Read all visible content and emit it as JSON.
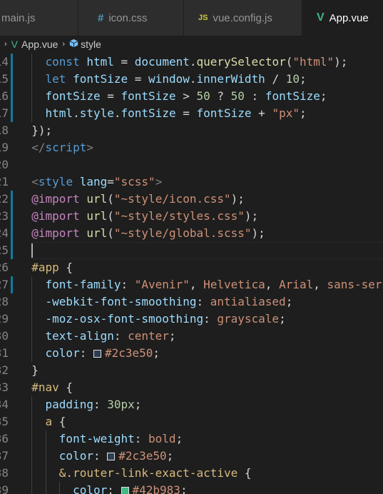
{
  "tabs": [
    {
      "label": "main.js",
      "icon": "file-js-icon",
      "active": false
    },
    {
      "label": "icon.css",
      "icon": "hash-icon",
      "active": false
    },
    {
      "label": "vue.config.js",
      "icon": "js-icon",
      "active": false
    },
    {
      "label": "App.vue",
      "icon": "vue-icon",
      "active": true
    }
  ],
  "tab_glyphs": {
    "hash": "#",
    "js": "JS",
    "vue": "V"
  },
  "breadcrumb": {
    "file": "App.vue",
    "section": "style",
    "separator": "›"
  },
  "colors": {
    "background": "#1e1e1e",
    "tab_inactive": "#2d2d2d",
    "vue_green": "#41b883",
    "swatch_a": "#2c3e50",
    "swatch_b": "#42b983"
  },
  "lines": [
    {
      "n": "14",
      "mod": true,
      "tokens": [
        [
          "    ",
          ""
        ],
        [
          "const",
          "kw"
        ],
        [
          " ",
          ""
        ],
        [
          "html",
          "vr"
        ],
        [
          " = ",
          "pu"
        ],
        [
          "document",
          "vr"
        ],
        [
          ".",
          "pu"
        ],
        [
          "querySelector",
          "fn"
        ],
        [
          "(",
          "pu"
        ],
        [
          "\"html\"",
          "st"
        ],
        [
          ");",
          "pu"
        ]
      ]
    },
    {
      "n": "15",
      "mod": true,
      "tokens": [
        [
          "    ",
          ""
        ],
        [
          "let",
          "kw"
        ],
        [
          " ",
          ""
        ],
        [
          "fontSize",
          "vr"
        ],
        [
          " = ",
          "pu"
        ],
        [
          "window",
          "vr"
        ],
        [
          ".",
          "pu"
        ],
        [
          "innerWidth",
          "vr"
        ],
        [
          " / ",
          "pu"
        ],
        [
          "10",
          "nm"
        ],
        [
          ";",
          "pu"
        ]
      ]
    },
    {
      "n": "16",
      "mod": true,
      "tokens": [
        [
          "    ",
          ""
        ],
        [
          "fontSize",
          "vr"
        ],
        [
          " = ",
          "pu"
        ],
        [
          "fontSize",
          "vr"
        ],
        [
          " > ",
          "pu"
        ],
        [
          "50",
          "nm"
        ],
        [
          " ? ",
          "pu"
        ],
        [
          "50",
          "nm"
        ],
        [
          " : ",
          "pu"
        ],
        [
          "fontSize",
          "vr"
        ],
        [
          ";",
          "pu"
        ]
      ]
    },
    {
      "n": "17",
      "mod": true,
      "tokens": [
        [
          "    ",
          ""
        ],
        [
          "html",
          "vr"
        ],
        [
          ".",
          "pu"
        ],
        [
          "style",
          "vr"
        ],
        [
          ".",
          "pu"
        ],
        [
          "fontSize",
          "vr"
        ],
        [
          " = ",
          "pu"
        ],
        [
          "fontSize",
          "vr"
        ],
        [
          " + ",
          "pu"
        ],
        [
          "\"px\"",
          "st"
        ],
        [
          ";",
          "pu"
        ]
      ]
    },
    {
      "n": "18",
      "mod": false,
      "tokens": [
        [
          "  ",
          ""
        ],
        [
          "});",
          "pu"
        ]
      ]
    },
    {
      "n": "19",
      "mod": false,
      "tokens": [
        [
          "  ",
          ""
        ],
        [
          "</",
          "br"
        ],
        [
          "script",
          "tg"
        ],
        [
          ">",
          "br"
        ]
      ]
    },
    {
      "n": "20",
      "mod": false,
      "tokens": []
    },
    {
      "n": "21",
      "mod": false,
      "tokens": [
        [
          "  ",
          ""
        ],
        [
          "<",
          "br"
        ],
        [
          "style",
          "tg"
        ],
        [
          " ",
          ""
        ],
        [
          "lang",
          "at"
        ],
        [
          "=",
          "pu"
        ],
        [
          "\"scss\"",
          "st"
        ],
        [
          ">",
          "br"
        ]
      ]
    },
    {
      "n": "22",
      "mod": true,
      "tokens": [
        [
          "  ",
          ""
        ],
        [
          "@import",
          "imp"
        ],
        [
          " ",
          ""
        ],
        [
          "url",
          "fn"
        ],
        [
          "(",
          "pu"
        ],
        [
          "\"~style/icon.css\"",
          "st"
        ],
        [
          ");",
          "pu"
        ]
      ]
    },
    {
      "n": "23",
      "mod": true,
      "tokens": [
        [
          "  ",
          ""
        ],
        [
          "@import",
          "imp"
        ],
        [
          " ",
          ""
        ],
        [
          "url",
          "fn"
        ],
        [
          "(",
          "pu"
        ],
        [
          "\"~style/styles.css\"",
          "st"
        ],
        [
          ");",
          "pu"
        ]
      ]
    },
    {
      "n": "24",
      "mod": true,
      "tokens": [
        [
          "  ",
          ""
        ],
        [
          "@import",
          "imp"
        ],
        [
          " ",
          ""
        ],
        [
          "url",
          "fn"
        ],
        [
          "(",
          "pu"
        ],
        [
          "\"~style/global.scss\"",
          "st"
        ],
        [
          ");",
          "pu"
        ]
      ]
    },
    {
      "n": "25",
      "mod": true,
      "current": true,
      "tokens": []
    },
    {
      "n": "26",
      "mod": false,
      "tokens": [
        [
          "  ",
          ""
        ],
        [
          "#app",
          "sel"
        ],
        [
          " {",
          "pu"
        ]
      ]
    },
    {
      "n": "27",
      "mod": true,
      "tokens": [
        [
          "    ",
          ""
        ],
        [
          "font-family",
          "pr"
        ],
        [
          ": ",
          "pu"
        ],
        [
          "\"Avenir\"",
          "st"
        ],
        [
          ", ",
          "pu"
        ],
        [
          "Helvetica",
          "cv"
        ],
        [
          ", ",
          "pu"
        ],
        [
          "Arial",
          "cv"
        ],
        [
          ", ",
          "pu"
        ],
        [
          "sans-serif",
          "cv"
        ],
        [
          ";",
          "pu"
        ]
      ]
    },
    {
      "n": "28",
      "mod": false,
      "tokens": [
        [
          "    ",
          ""
        ],
        [
          "-webkit-font-smoothing",
          "pr"
        ],
        [
          ": ",
          "pu"
        ],
        [
          "antialiased",
          "cv"
        ],
        [
          ";",
          "pu"
        ]
      ]
    },
    {
      "n": "29",
      "mod": false,
      "tokens": [
        [
          "    ",
          ""
        ],
        [
          "-moz-osx-font-smoothing",
          "pr"
        ],
        [
          ": ",
          "pu"
        ],
        [
          "grayscale",
          "cv"
        ],
        [
          ";",
          "pu"
        ]
      ]
    },
    {
      "n": "30",
      "mod": false,
      "tokens": [
        [
          "    ",
          ""
        ],
        [
          "text-align",
          "pr"
        ],
        [
          ": ",
          "pu"
        ],
        [
          "center",
          "cv"
        ],
        [
          ";",
          "pu"
        ]
      ]
    },
    {
      "n": "31",
      "mod": false,
      "tokens": [
        [
          "    ",
          ""
        ],
        [
          "color",
          "pr"
        ],
        [
          ": ",
          "pu"
        ],
        [
          "#2c3e50",
          "cv",
          "swatch_a"
        ],
        [
          ";",
          "pu"
        ]
      ]
    },
    {
      "n": "32",
      "mod": false,
      "tokens": [
        [
          "  ",
          ""
        ],
        [
          "}",
          "pu"
        ]
      ]
    },
    {
      "n": "33",
      "mod": false,
      "tokens": [
        [
          "  ",
          ""
        ],
        [
          "#nav",
          "sel"
        ],
        [
          " {",
          "pu"
        ]
      ]
    },
    {
      "n": "34",
      "mod": false,
      "tokens": [
        [
          "    ",
          ""
        ],
        [
          "padding",
          "pr"
        ],
        [
          ": ",
          "pu"
        ],
        [
          "30px",
          "nm"
        ],
        [
          ";",
          "pu"
        ]
      ]
    },
    {
      "n": "35",
      "mod": false,
      "tokens": [
        [
          "    ",
          ""
        ],
        [
          "a",
          "sel"
        ],
        [
          " {",
          "pu"
        ]
      ]
    },
    {
      "n": "36",
      "mod": false,
      "tokens": [
        [
          "      ",
          ""
        ],
        [
          "font-weight",
          "pr"
        ],
        [
          ": ",
          "pu"
        ],
        [
          "bold",
          "cv"
        ],
        [
          ";",
          "pu"
        ]
      ]
    },
    {
      "n": "37",
      "mod": false,
      "tokens": [
        [
          "      ",
          ""
        ],
        [
          "color",
          "pr"
        ],
        [
          ": ",
          "pu"
        ],
        [
          "#2c3e50",
          "cv",
          "swatch_a"
        ],
        [
          ";",
          "pu"
        ]
      ]
    },
    {
      "n": "38",
      "mod": false,
      "tokens": [
        [
          "      ",
          ""
        ],
        [
          "&.router-link-exact-active",
          "sel"
        ],
        [
          " {",
          "pu"
        ]
      ]
    },
    {
      "n": "39",
      "mod": false,
      "tokens": [
        [
          "        ",
          ""
        ],
        [
          "color",
          "pr"
        ],
        [
          ": ",
          "pu"
        ],
        [
          "#42b983",
          "cv",
          "swatch_b"
        ],
        [
          ";",
          "pu"
        ]
      ]
    }
  ]
}
